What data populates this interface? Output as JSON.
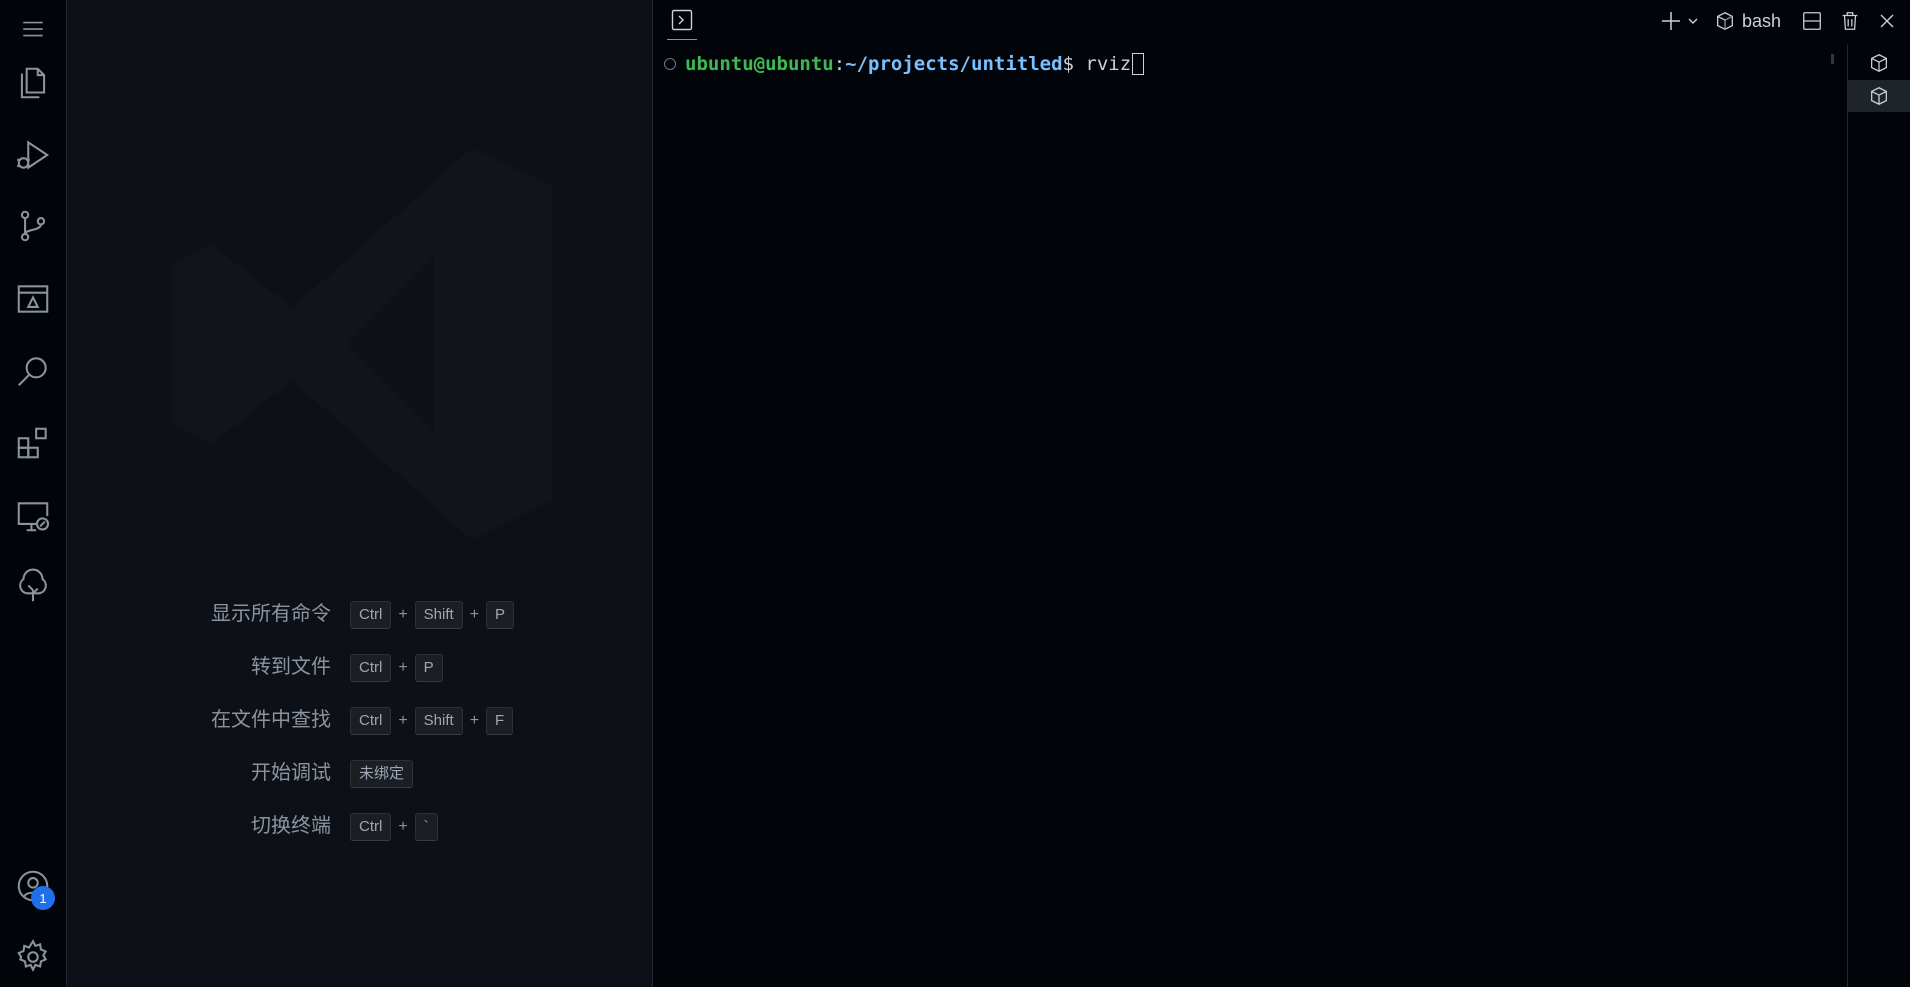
{
  "activity_bar": {
    "items": [
      "menu-icon",
      "files-icon",
      "run-debug-icon",
      "source-control-icon",
      "remote-explorer-icon",
      "search-icon",
      "extensions-icon",
      "remote-monitor-icon",
      "tree-icon"
    ],
    "accounts_badge": "1"
  },
  "shortcuts": [
    {
      "label": "显示所有命令",
      "keys": [
        "Ctrl",
        "Shift",
        "P"
      ]
    },
    {
      "label": "转到文件",
      "keys": [
        "Ctrl",
        "P"
      ]
    },
    {
      "label": "在文件中查找",
      "keys": [
        "Ctrl",
        "Shift",
        "F"
      ]
    },
    {
      "label": "开始调试",
      "keys": [
        "未绑定"
      ]
    },
    {
      "label": "切换终端",
      "keys": [
        "Ctrl",
        "`"
      ]
    }
  ],
  "terminal": {
    "shell_label": "bash",
    "prompt_user": "ubuntu@ubuntu",
    "prompt_colon": ":",
    "prompt_path": "~/projects/untitled",
    "prompt_dollar": "$ ",
    "command": "rviz"
  },
  "colors": {
    "accent": "#1f6feb",
    "prompt_user": "#3fb950",
    "prompt_path": "#79c0ff"
  }
}
